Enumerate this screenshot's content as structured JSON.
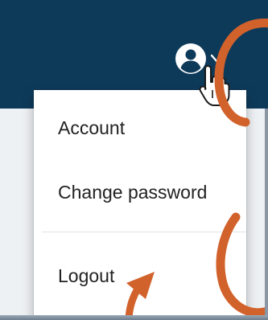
{
  "navbar": {
    "background_color": "#0e3a5a",
    "user_icon": "user-circle-icon",
    "caret_icon": "chevron-down-icon"
  },
  "dropdown": {
    "items": [
      {
        "label": "Account"
      },
      {
        "label": "Change password"
      },
      {
        "label": "Logout"
      }
    ]
  },
  "annotation": {
    "color": "#d2622b"
  }
}
